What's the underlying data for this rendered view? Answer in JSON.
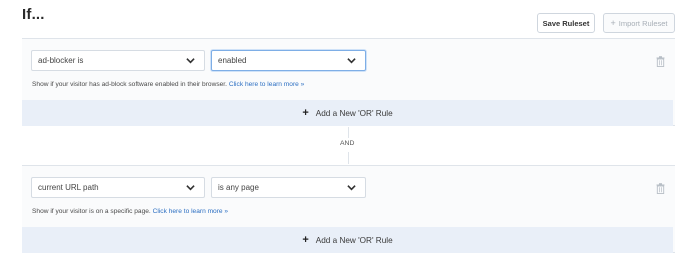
{
  "header": {
    "title": "If...",
    "save_label": "Save Ruleset",
    "import_label": "Import Ruleset"
  },
  "rules": [
    {
      "field": "ad-blocker is",
      "operator": "enabled",
      "help_text": "Show if your visitor has ad-block software enabled in their browser.",
      "help_link": "Click here to learn more »",
      "add_or_label": "Add a New 'OR' Rule"
    },
    {
      "field": "current URL path",
      "operator": "is any page",
      "help_text": "Show if your visitor is on a specific page.",
      "help_link": "Click here to learn more »",
      "add_or_label": "Add a New 'OR' Rule"
    }
  ],
  "connector": "AND",
  "icons": {
    "chevron": "chevron-down-icon",
    "trash": "trash-icon",
    "plus": "plus-icon"
  },
  "colors": {
    "link": "#2c6fc2",
    "add_or_bg": "#e9eff8",
    "focus_border": "#7eaee6"
  }
}
